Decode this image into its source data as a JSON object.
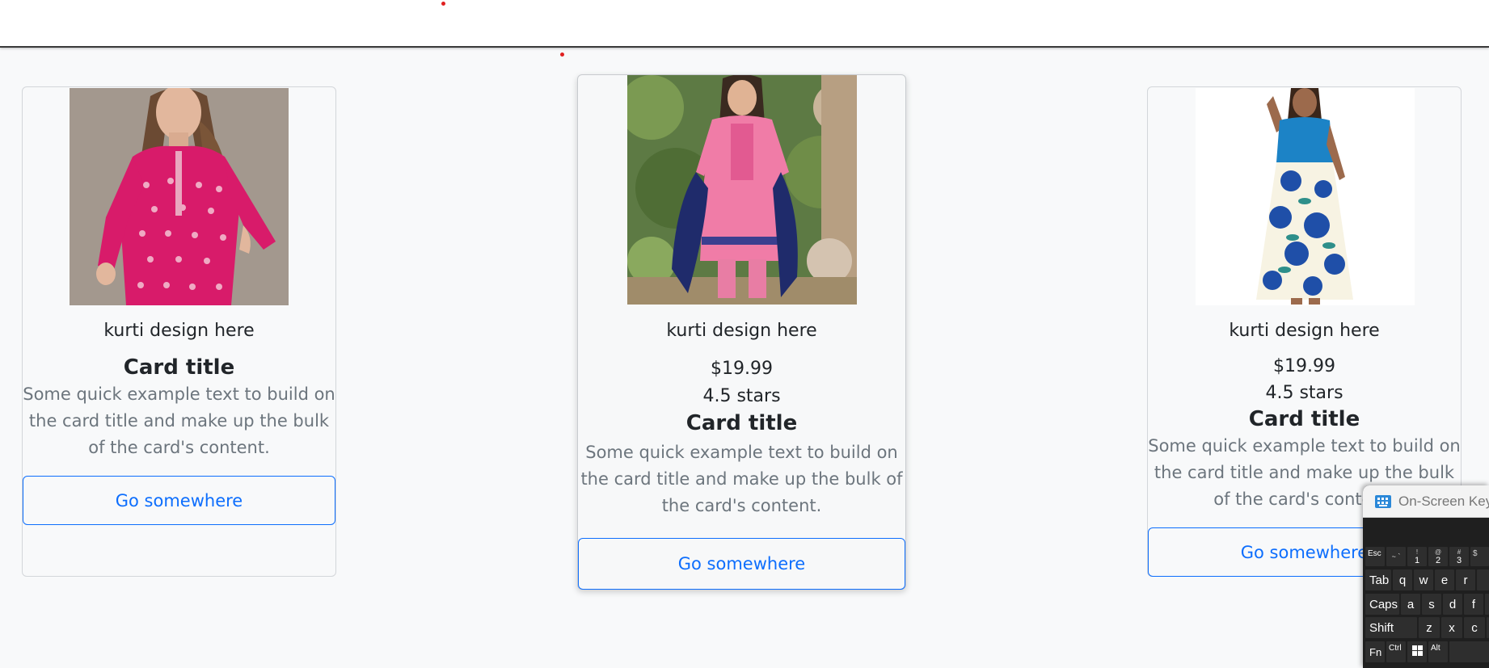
{
  "cards": [
    {
      "image_alt": "pink printed kurti",
      "kurti_text": "kurti design here",
      "title": "Card title",
      "text": "Some quick example text to build on the card title and make up the bulk of the card's content.",
      "button_label": "Go somewhere"
    },
    {
      "image_alt": "pink salwar suit with navy dupatta",
      "kurti_text": "kurti design here",
      "price": "$19.99",
      "rating": "4.5 stars",
      "title": "Card title",
      "text": "Some quick example text to build on the card title and make up the bulk of the card's content.",
      "button_label": "Go somewhere"
    },
    {
      "image_alt": "blue floral maxi dress",
      "kurti_text": "kurti design here",
      "price": "$19.99",
      "rating": "4.5 stars",
      "title": "Card title",
      "text": "Some quick example text to build on the card title and make up the bulk of the card's content.",
      "button_label": "Go somewhere"
    }
  ],
  "onscreen_keyboard": {
    "title": "On-Screen Key",
    "keys": {
      "esc": "Esc",
      "tilde": "~ `",
      "k1_top": "!",
      "k1": "1",
      "k2_top": "@",
      "k2": "2",
      "k3_top": "#",
      "k3": "3",
      "k4_top": "$",
      "tab": "Tab",
      "q": "q",
      "w": "w",
      "e": "e",
      "r": "r",
      "caps": "Caps",
      "a": "a",
      "s": "s",
      "d": "d",
      "f": "f",
      "shift": "Shift",
      "z": "z",
      "x": "x",
      "c": "c",
      "fn": "Fn",
      "ctrl": "Ctrl",
      "alt": "Alt"
    }
  },
  "colors": {
    "accent": "#0d6efd",
    "muted_text": "#6c757d",
    "page_bg": "#f8f9fa",
    "marker_red": "#e02020"
  }
}
